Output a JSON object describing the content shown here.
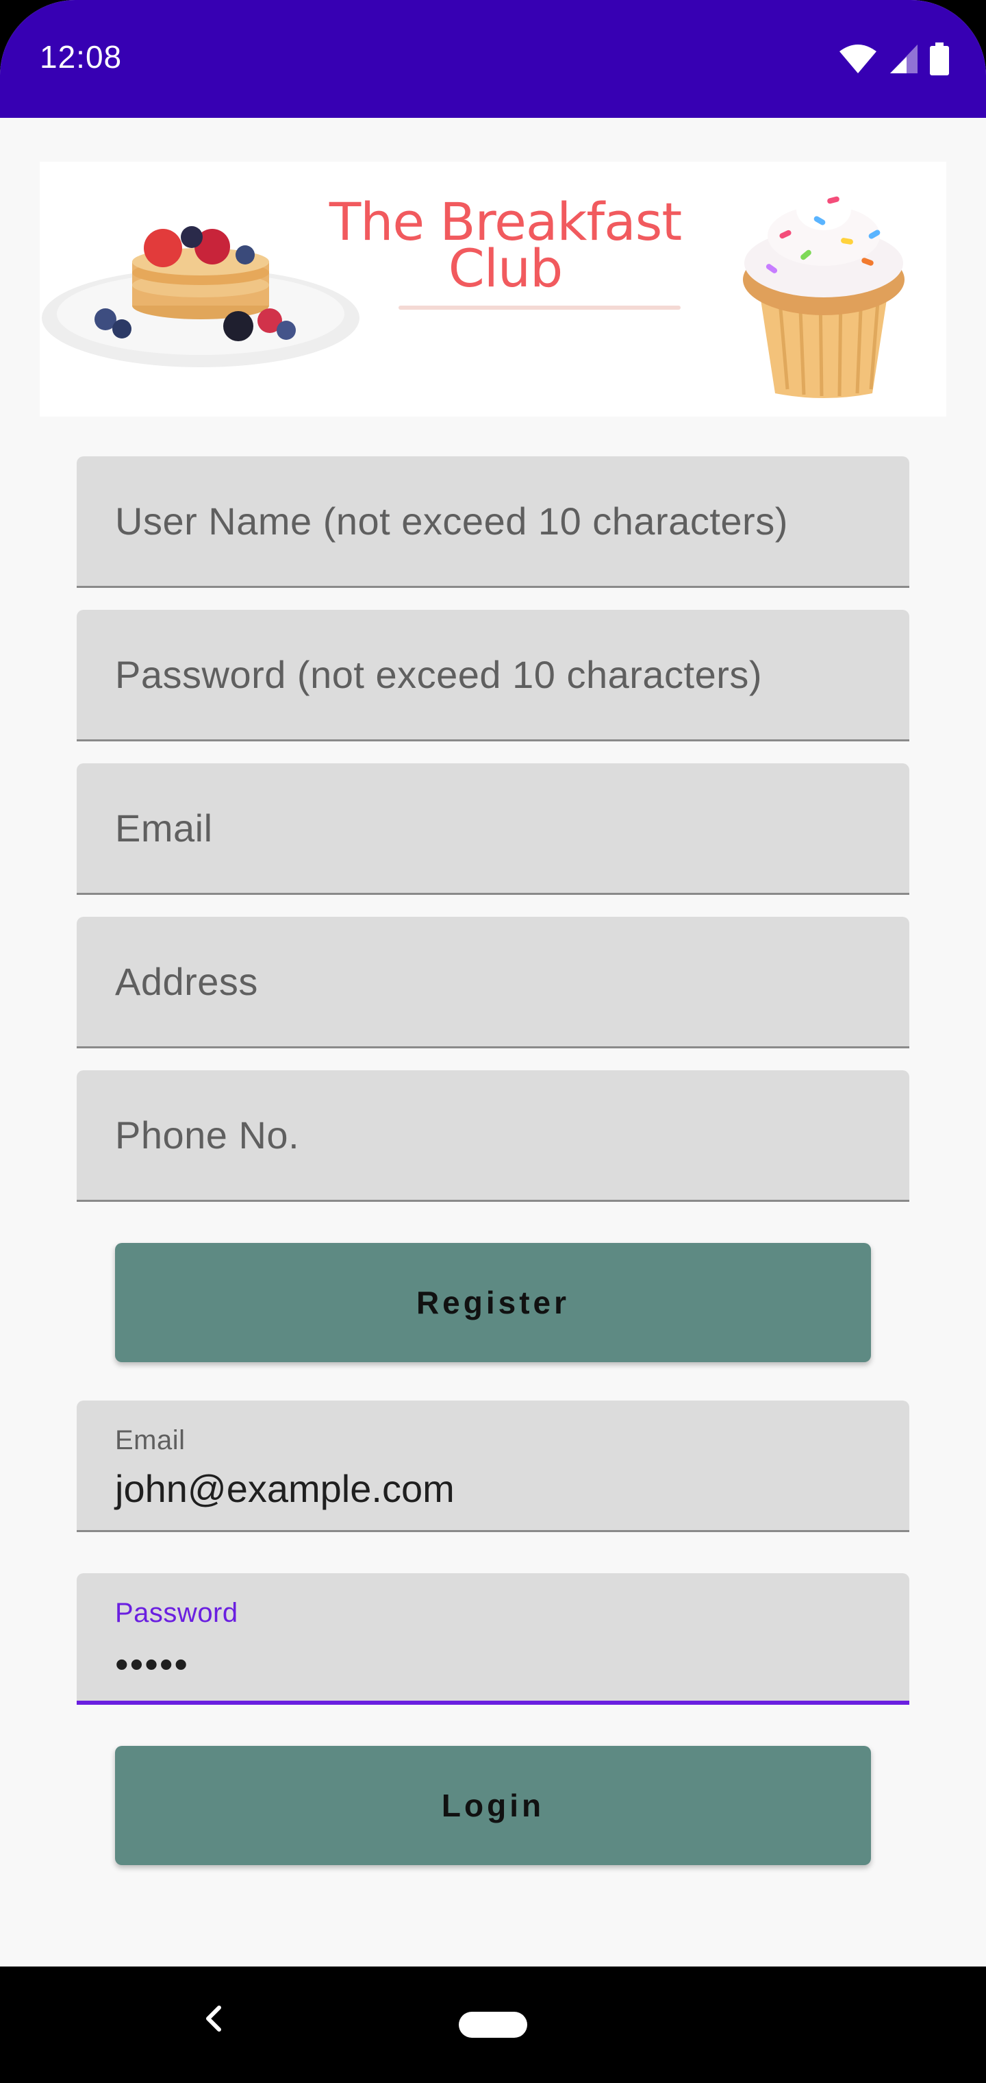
{
  "status_bar": {
    "time": "12:08",
    "icons": [
      "wifi-icon",
      "signal-icon",
      "battery-icon"
    ],
    "background": "#3700b3"
  },
  "banner": {
    "title_line1": "The Breakfast",
    "title_line2": "Club",
    "title_color": "#f15a5e"
  },
  "register_form": {
    "username_placeholder": "User Name (not exceed 10 characters)",
    "password_placeholder": "Password (not exceed 10 characters)",
    "email_placeholder": "Email",
    "address_placeholder": "Address",
    "phone_placeholder": "Phone No.",
    "register_label": "Register"
  },
  "login_form": {
    "email_label": "Email",
    "email_value": "john@example.com",
    "password_label": "Password",
    "password_value": "•••••",
    "login_label": "Login",
    "focus_color": "#6a1fe0"
  },
  "colors": {
    "button": "#5e8a83",
    "field": "#dcdcdc",
    "background": "#f8f8f8"
  },
  "nav_bar": {
    "icons": [
      "back-icon",
      "home-icon"
    ]
  }
}
